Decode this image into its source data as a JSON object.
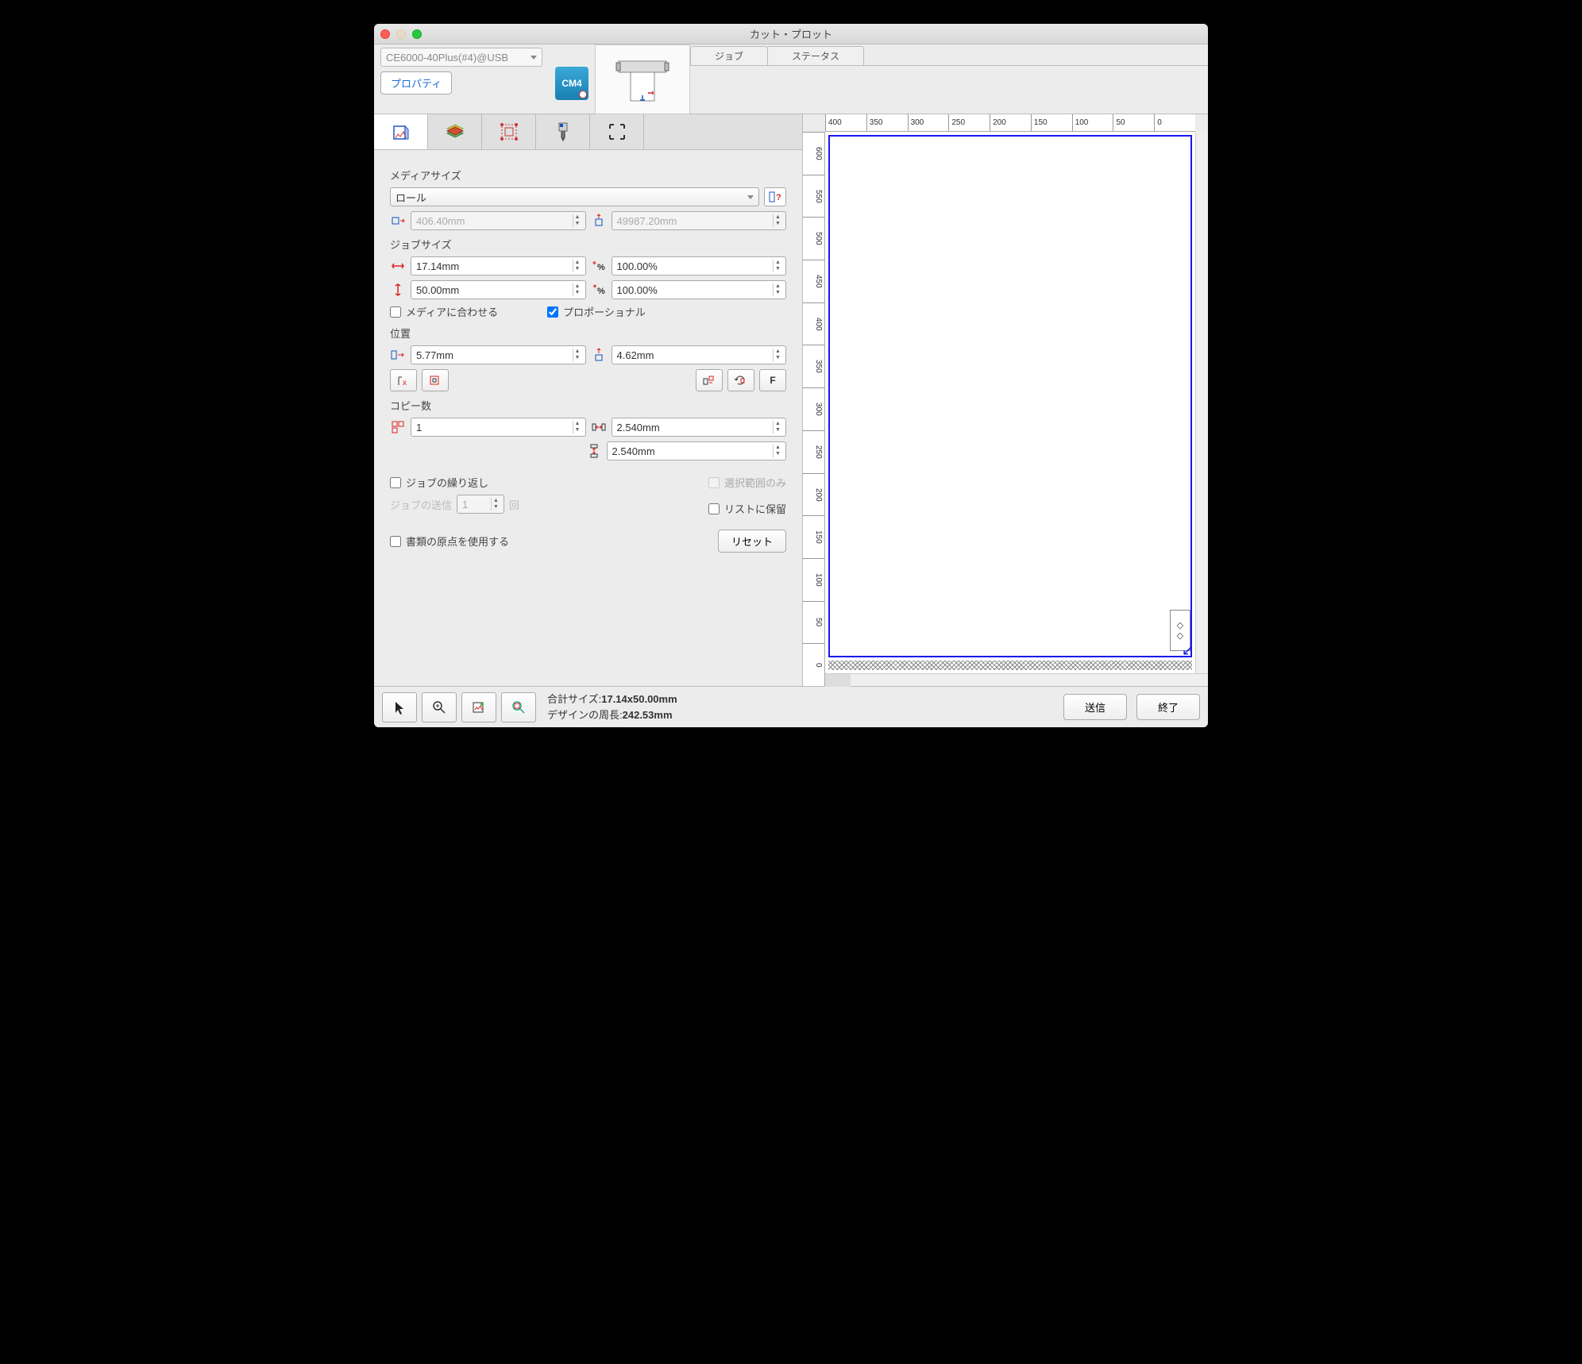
{
  "window": {
    "title": "カット・プロット"
  },
  "device": {
    "name": "CE6000-40Plus(#4)@USB",
    "properties_btn": "プロパティ",
    "cm4_label": "CM4"
  },
  "job_tabs": {
    "job": "ジョブ",
    "status": "ステータス"
  },
  "sections": {
    "media_size": "メディアサイズ",
    "job_size": "ジョブサイズ",
    "position": "位置",
    "copies": "コピー数"
  },
  "media": {
    "type": "ロール",
    "width": "406.40mm",
    "height": "49987.20mm"
  },
  "job": {
    "width": "17.14mm",
    "height": "50.00mm",
    "scale_x": "100.00%",
    "scale_y": "100.00%",
    "fit_media": "メディアに合わせる",
    "proportional": "プロポーショナル"
  },
  "position": {
    "x": "5.77mm",
    "y": "4.62mm",
    "f_label": "F"
  },
  "copies": {
    "count": "1",
    "gap_x": "2.540mm",
    "gap_y": "2.540mm"
  },
  "repeat": {
    "job_repeat": "ジョブの繰り返し",
    "send_label": "ジョブの送信",
    "send_count": "1",
    "send_unit": "回",
    "selection_only": "選択範囲のみ",
    "hold_list": "リストに保留"
  },
  "use_origin": "書類の原点を使用する",
  "reset_btn": "リセット",
  "ruler_h": [
    "400",
    "350",
    "300",
    "250",
    "200",
    "150",
    "100",
    "50",
    "0"
  ],
  "ruler_v": [
    "600",
    "550",
    "500",
    "450",
    "400",
    "350",
    "300",
    "250",
    "200",
    "150",
    "100",
    "50",
    "0"
  ],
  "status": {
    "total_label": "合計サイズ:",
    "total_value": "17.14x50.00mm",
    "perimeter_label": "デザインの周長:",
    "perimeter_value": "242.53mm"
  },
  "actions": {
    "send": "送信",
    "close": "終了"
  }
}
